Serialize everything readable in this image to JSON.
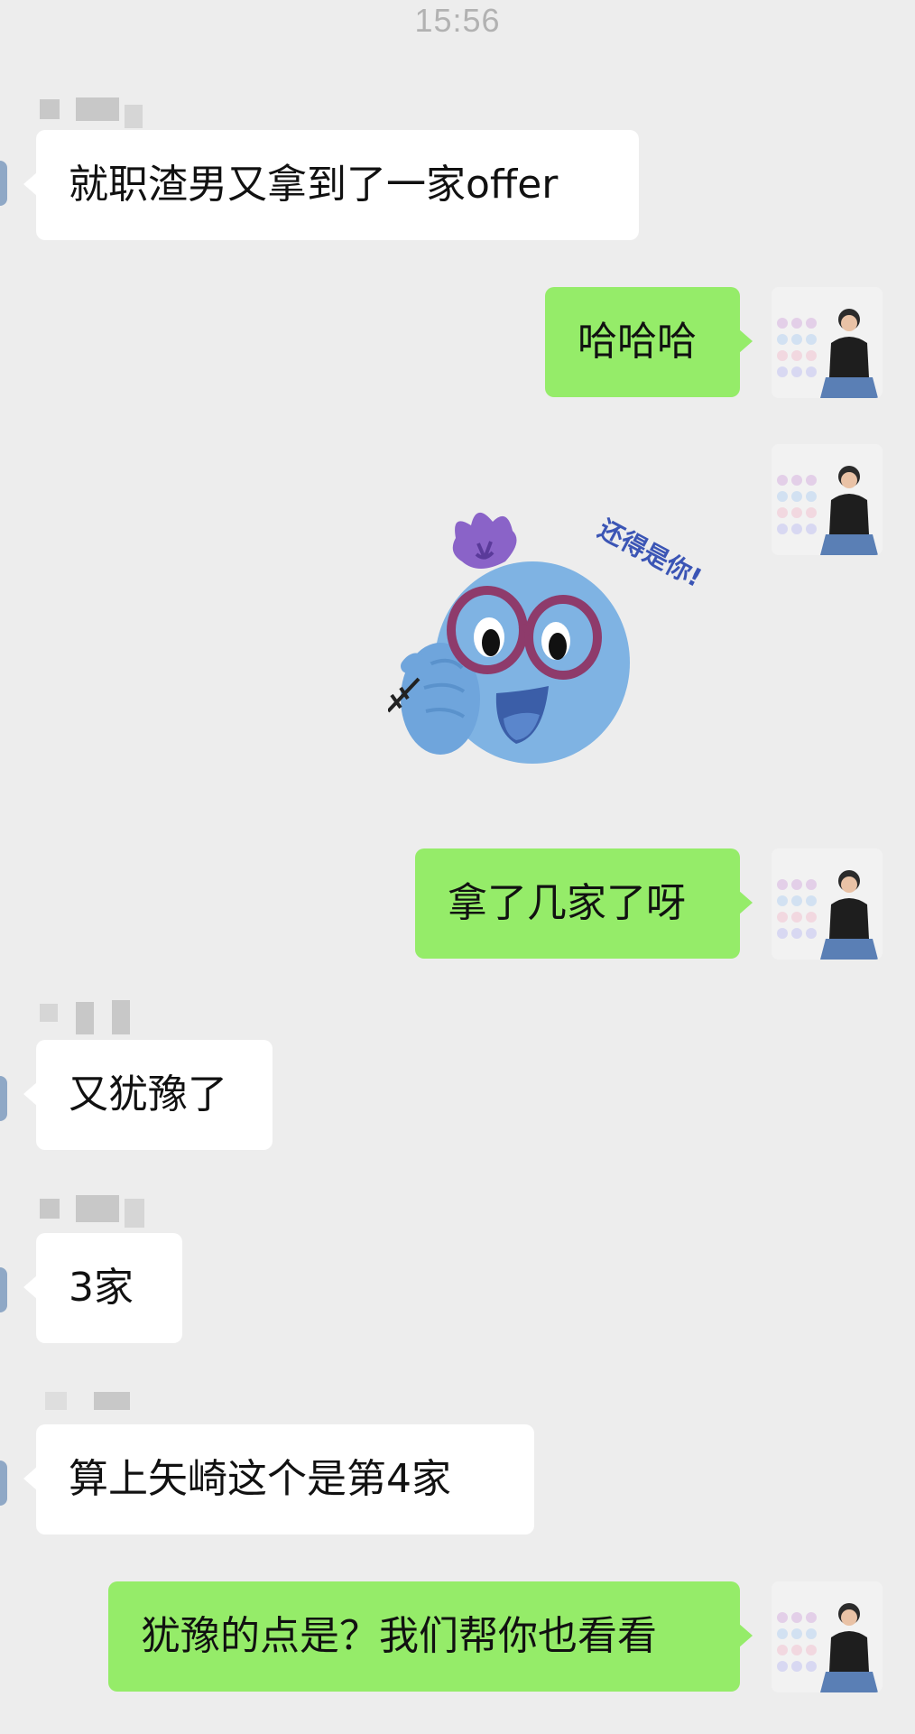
{
  "status": {
    "time": "15:56"
  },
  "messages": [
    {
      "side": "in",
      "text": "就职渣男又拿到了一家offer"
    },
    {
      "side": "out",
      "text": "哈哈哈"
    },
    {
      "side": "out",
      "type": "sticker",
      "sticker_text": "还得是你!"
    },
    {
      "side": "out",
      "text": "拿了几家了呀"
    },
    {
      "side": "in",
      "text": "又犹豫了"
    },
    {
      "side": "in",
      "text": "3家"
    },
    {
      "side": "in",
      "text": "算上矢崎这个是第4家"
    },
    {
      "side": "out",
      "text": "犹豫的点是？我们帮你也看看"
    }
  ],
  "colors": {
    "background": "#ededed",
    "incoming_bubble": "#ffffff",
    "outgoing_bubble": "#95ec69",
    "timestamp": "#b2b2b2"
  },
  "icons": {
    "user_avatar": "user-photo-avatar",
    "sticker": "blue-blob-glasses-thumbs-up-sticker"
  }
}
